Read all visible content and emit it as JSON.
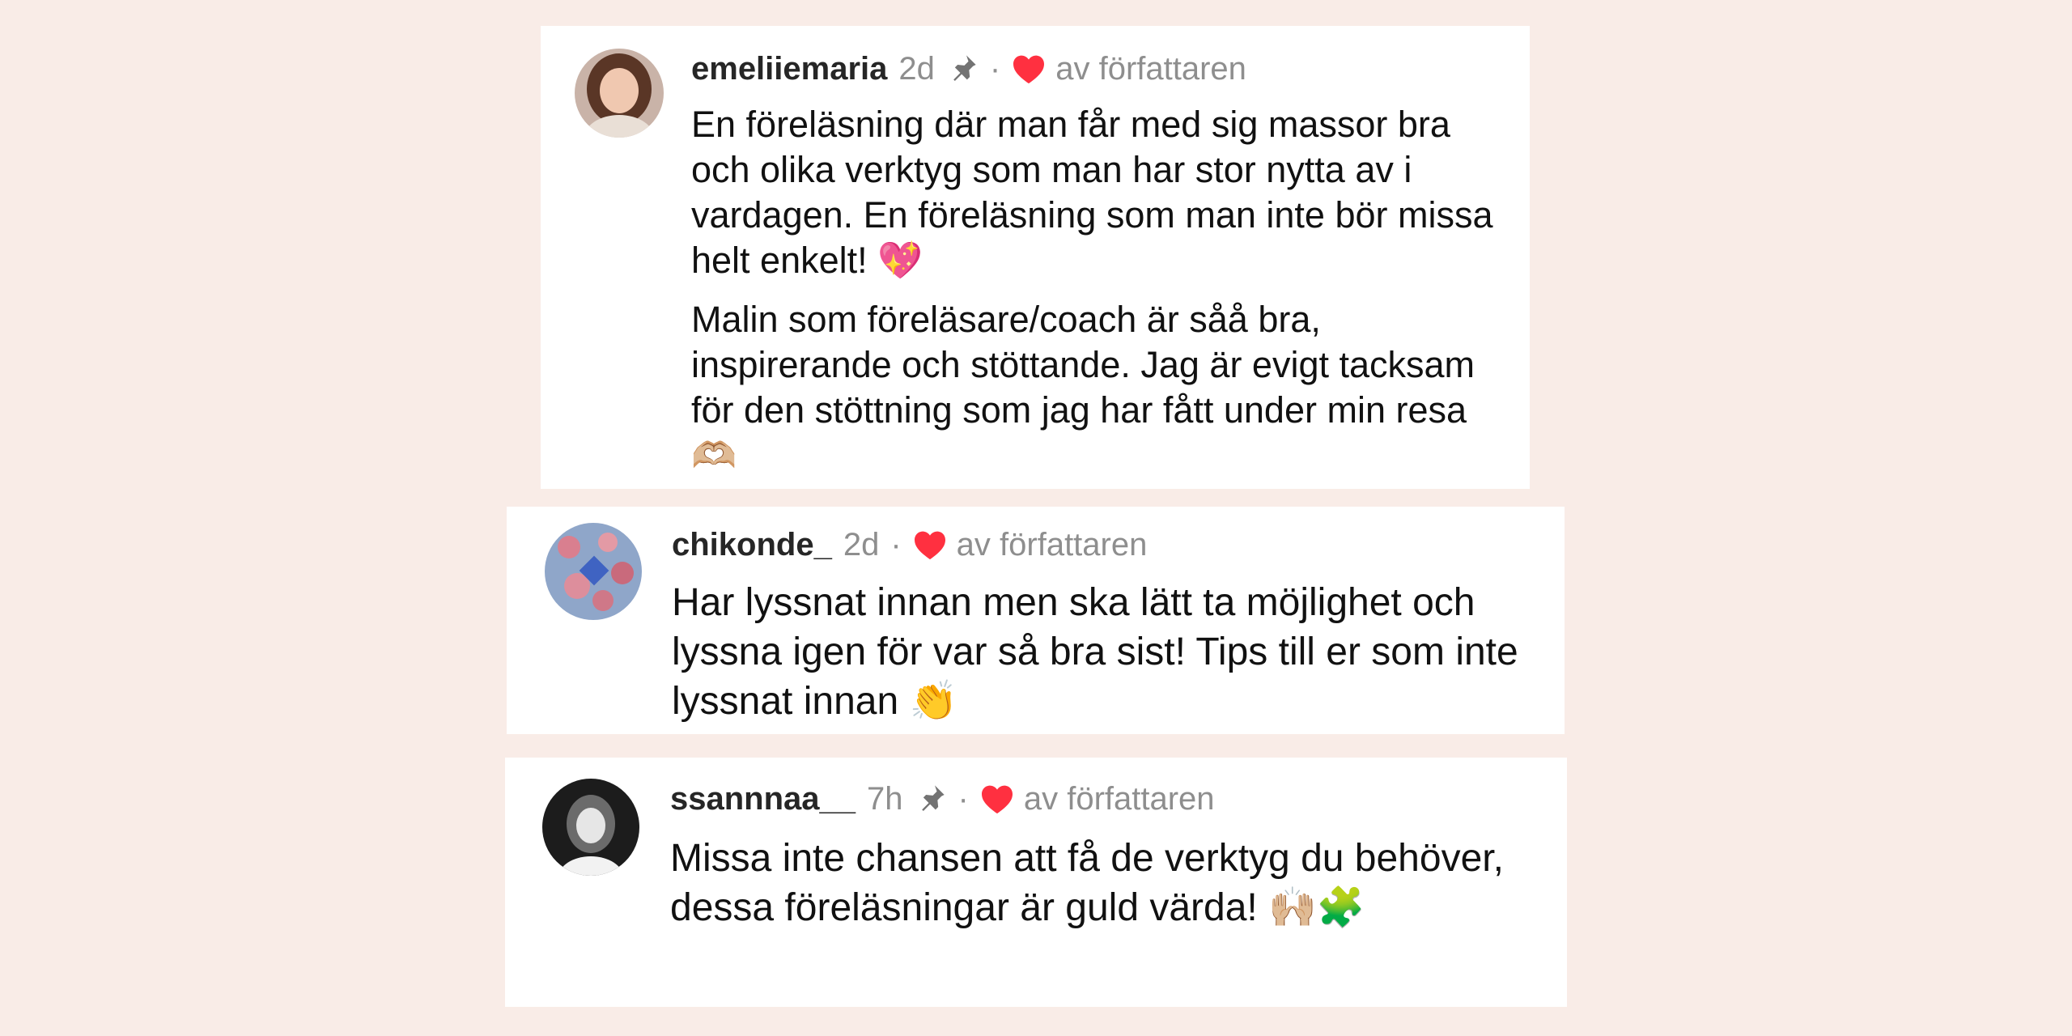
{
  "comments": [
    {
      "username": "emeliiemaria",
      "time": "2d",
      "pinned": true,
      "separator": "·",
      "liked_by_author_label": "av författaren",
      "paragraphs": [
        "En föreläsning där man får med sig massor bra och olika verktyg som man har stor nytta av i vardagen. En föreläsning som man inte bör missa helt enkelt! 💖",
        "Malin som föreläsare/coach är såå bra, inspirerande och stöttande. Jag är evigt tacksam för den stöttning som jag har fått under min resa 🫶🏼"
      ]
    },
    {
      "username": "chikonde_",
      "time": "2d",
      "pinned": false,
      "separator": "·",
      "liked_by_author_label": "av författaren",
      "paragraphs": [
        "Har lyssnat innan men ska lätt ta möjlighet och lyssna igen för var så bra sist! Tips till er som inte lyssnat innan 👏"
      ]
    },
    {
      "username": "ssannnaa__",
      "time": "7h",
      "pinned": true,
      "separator": "·",
      "liked_by_author_label": "av författaren",
      "paragraphs": [
        "Missa inte chansen att få de verktyg du behöver, dessa föreläsningar är guld värda! 🙌🏼🧩"
      ]
    }
  ],
  "colors": {
    "background": "#f9ece7",
    "card": "#ffffff",
    "heart": "#ff3040",
    "username": "#262626",
    "meta": "#8e8e8e"
  }
}
